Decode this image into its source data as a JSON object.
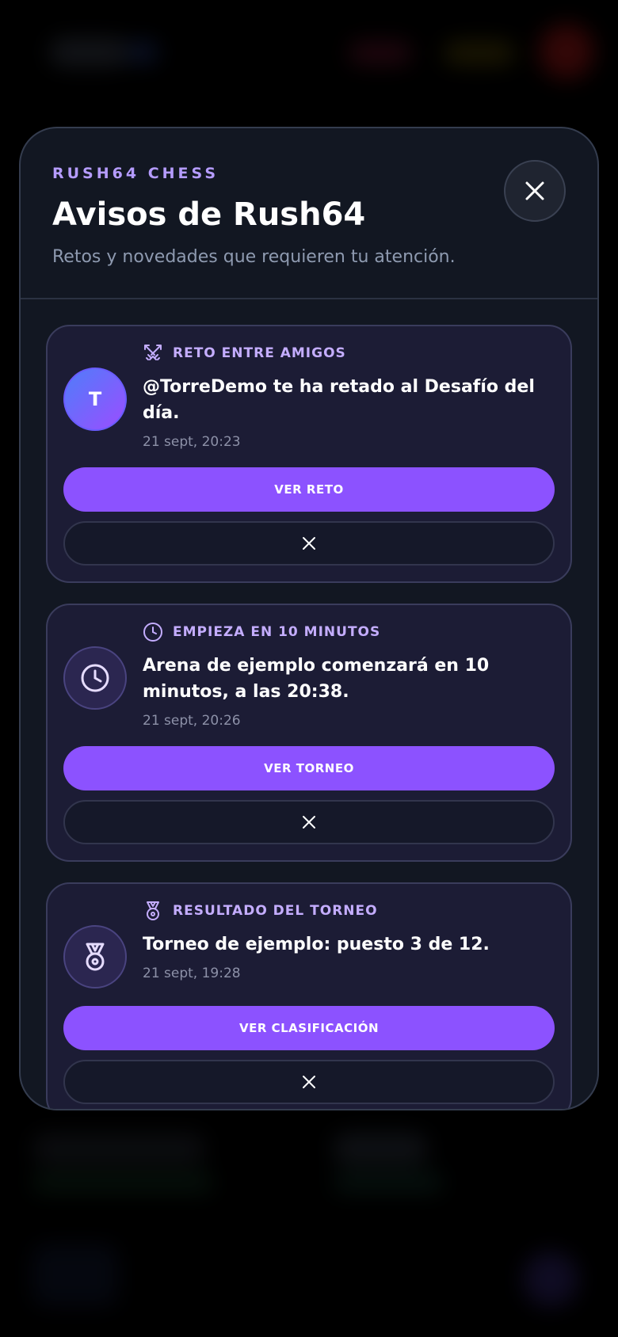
{
  "modal": {
    "eyebrow": "RUSH64 CHESS",
    "title": "Avisos de Rush64",
    "subtitle": "Retos y novedades que requieren tu atención.",
    "close_icon": "close-icon"
  },
  "notifications": [
    {
      "kind": "RETO ENTRE AMIGOS",
      "kind_icon": "swords-icon",
      "avatar_letter": "T",
      "message": "@TorreDemo te ha retado al Desafío del día.",
      "time": "21 sept, 20:23",
      "action": "VER RETO",
      "dismiss_icon": "close-icon"
    },
    {
      "kind": "EMPIEZA EN 10 MINUTOS",
      "kind_icon": "clock-icon",
      "avatar_icon": "clock-icon",
      "message": "Arena de ejemplo comenzará en 10 minutos, a las 20:38.",
      "time": "21 sept, 20:26",
      "action": "VER TORNEO",
      "dismiss_icon": "close-icon"
    },
    {
      "kind": "RESULTADO DEL TORNEO",
      "kind_icon": "medal-icon",
      "avatar_icon": "medal-icon",
      "message": "Torneo de ejemplo: puesto 3 de 12.",
      "time": "21 sept, 19:28",
      "action": "VER CLASIFICACIÓN",
      "dismiss_icon": "close-icon"
    }
  ],
  "colors": {
    "accent": "#8c52ff",
    "accent_text": "#c4adff",
    "card_bg": "#1c1c35",
    "modal_bg": "#121722"
  }
}
